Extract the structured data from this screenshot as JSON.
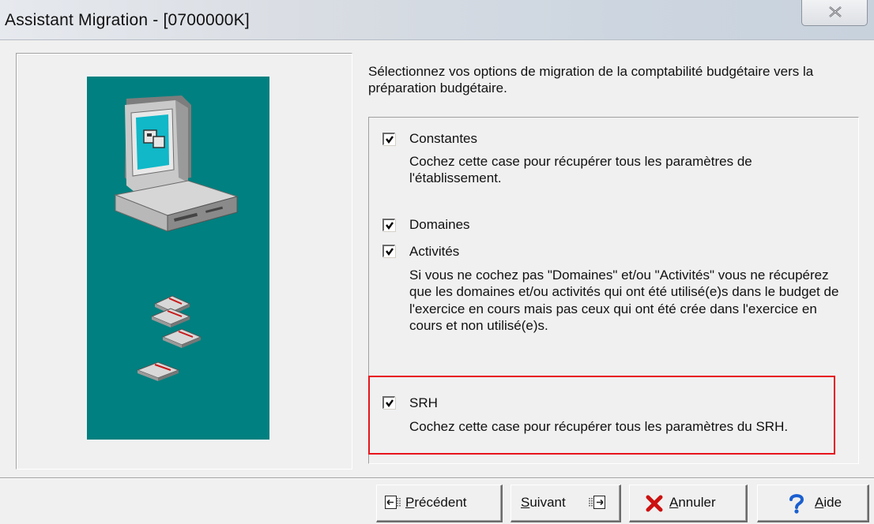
{
  "window": {
    "title": "Assistant Migration - [0700000K]",
    "close_icon": "close-icon"
  },
  "intro_text": "Sélectionnez vos options de migration de la comptabilité budgétaire vers la préparation budgétaire.",
  "options": [
    {
      "label": "Constantes",
      "checked": true,
      "description": "Cochez cette case pour récupérer tous les paramètres de l'établissement."
    },
    {
      "label": "Domaines",
      "checked": true
    },
    {
      "label": "Activités",
      "checked": true,
      "description": "Si vous ne cochez pas \"Domaines\" et/ou \"Activités\" vous ne récupérez que les domaines et/ou activités qui ont été utilisé(e)s dans le budget de l'exercice en cours mais pas ceux qui ont été crée dans l'exercice en cours et non utilisé(e)s."
    },
    {
      "label": "SRH",
      "checked": true,
      "description": "Cochez cette case pour récupérer tous les paramètres du SRH."
    }
  ],
  "buttons": {
    "previous": "Précédent",
    "next": "Suivant",
    "cancel": "Annuler",
    "help": "Aide"
  },
  "colors": {
    "illustration_bg": "#008080",
    "highlight_border": "#e8141c",
    "help_icon": "#1a5fd0",
    "cancel_icon": "#cc1111"
  }
}
